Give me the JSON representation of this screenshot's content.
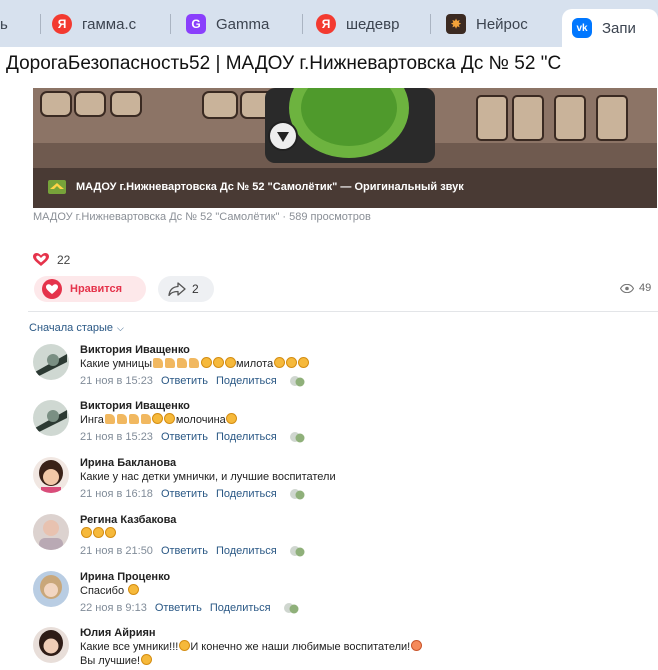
{
  "browser": {
    "tabs": [
      {
        "label": "ь",
        "icon": "none"
      },
      {
        "label": "гамма.с",
        "icon": "yandex-icon",
        "color": "#f33a30"
      },
      {
        "label": "Gamma",
        "icon": "gamma-icon",
        "color": "#8a3ffc"
      },
      {
        "label": "шедевр",
        "icon": "yandex-icon",
        "color": "#f33a30"
      },
      {
        "label": "Нейрос",
        "icon": "neuro-icon",
        "color": "#c9712a"
      },
      {
        "label": "Запи",
        "icon": "vk-icon",
        "color": "#0077ff",
        "active": true
      }
    ]
  },
  "page": {
    "title": "ДорогаБезопасность52 | МАДОУ г.Нижневартовска Дс № 52 \"С"
  },
  "video": {
    "caption": "МАДОУ г.Нижневартовска Дс № 52 \"Самолётик\" — Оригинальный звук",
    "meta": "МАДОУ г.Нижневартовска Дс № 52 \"Самолётик\" · 589 просмотров"
  },
  "reactions": {
    "like_count": "22",
    "like_label": "Нравится",
    "share_count": "2",
    "views_count": "49"
  },
  "comments_header": {
    "sort_label": "Сначала старые"
  },
  "comments": [
    {
      "author": "Виктория Иващенко",
      "prefix": "Какие умницы",
      "thumbs": 4,
      "emojis_mid": 3,
      "word": "милота",
      "emojis_end": 3,
      "date": "21 ноя в 15:23",
      "reply": "Ответить",
      "share": "Поделиться"
    },
    {
      "author": "Виктория Иващенко",
      "prefix": "Инга",
      "thumbs": 4,
      "emojis_mid": 2,
      "word": "молочина",
      "emojis_end": 1,
      "date": "21 ноя в 15:23",
      "reply": "Ответить",
      "share": "Поделиться"
    },
    {
      "author": "Ирина Бакланова",
      "text": "Какие у нас детки умнички, и лучшие воспитатели",
      "date": "21 ноя в 16:18",
      "reply": "Ответить",
      "share": "Поделиться"
    },
    {
      "author": "Регина Казбакова",
      "emojis_only": 3,
      "date": "21 ноя в 21:50",
      "reply": "Ответить",
      "share": "Поделиться"
    },
    {
      "author": "Ирина Проценко",
      "text": "Спасибо",
      "emojis_end": 1,
      "date": "22 ноя в 9:13",
      "reply": "Ответить",
      "share": "Поделиться"
    },
    {
      "author": "Юлия Айриян",
      "text": "Какие все умники!!!",
      "text2": "И конечно же наши любимые воспитатели!",
      "text3": "Вы лучшие!"
    }
  ],
  "colors": {
    "link": "#2a5885",
    "like_red": "#e5334b",
    "tabbar": "#d7e1ee",
    "muted": "#818c99"
  }
}
